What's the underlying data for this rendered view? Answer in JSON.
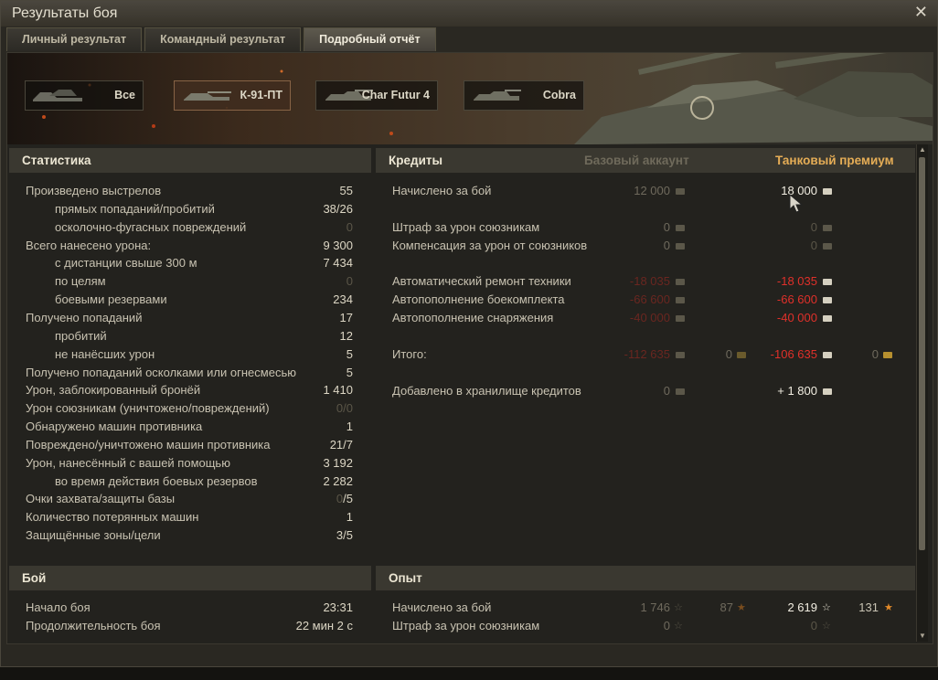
{
  "window": {
    "title": "Результаты боя"
  },
  "tabs": [
    "Личный результат",
    "Командный результат",
    "Подробный отчёт"
  ],
  "vehicles": [
    {
      "name": "Все",
      "icon": "tank-group-icon"
    },
    {
      "name": "К-91-ПТ",
      "icon": "tank-destroyer-icon"
    },
    {
      "name": "Char Futur 4",
      "icon": "medium-tank-icon"
    },
    {
      "name": "Cobra",
      "icon": "medium-tank-icon"
    }
  ],
  "stats": {
    "header": "Статистика",
    "rows": [
      {
        "label": "Произведено выстрелов",
        "value": "55",
        "indent": false,
        "dim": false
      },
      {
        "label": "прямых попаданий/пробитий",
        "value": "38/26",
        "indent": true,
        "dim": false
      },
      {
        "label": "осколочно-фугасных повреждений",
        "value": "0",
        "indent": true,
        "dim": true
      },
      {
        "label": "Всего нанесено урона:",
        "value": "9 300",
        "indent": false,
        "dim": false
      },
      {
        "label": "с дистанции свыше 300 м",
        "value": "7 434",
        "indent": true,
        "dim": false
      },
      {
        "label": "по целям",
        "value": "0",
        "indent": true,
        "dim": true
      },
      {
        "label": "боевыми резервами",
        "value": "234",
        "indent": true,
        "dim": false
      },
      {
        "label": "Получено попаданий",
        "value": "17",
        "indent": false,
        "dim": false
      },
      {
        "label": "пробитий",
        "value": "12",
        "indent": true,
        "dim": false
      },
      {
        "label": "не нанёсших урон",
        "value": "5",
        "indent": true,
        "dim": false
      },
      {
        "label": "Получено попаданий осколками или огнесмесью",
        "value": "5",
        "indent": false,
        "dim": false
      },
      {
        "label": "Урон, заблокированный бронёй",
        "value": "1 410",
        "indent": false,
        "dim": false
      },
      {
        "label": "Урон союзникам (уничтожено/повреждений)",
        "value": "0/0",
        "indent": false,
        "dim": true
      },
      {
        "label": "Обнаружено машин противника",
        "value": "1",
        "indent": false,
        "dim": false
      },
      {
        "label": "Повреждено/уничтожено машин противника",
        "value": "21/7",
        "indent": false,
        "dim": false
      },
      {
        "label": "Урон, нанесённый с вашей помощью",
        "value": "3 192",
        "indent": false,
        "dim": false
      },
      {
        "label": "во время действия боевых резервов",
        "value": "2 282",
        "indent": true,
        "dim": false
      },
      {
        "label": "Очки захвата/защиты базы",
        "value_dim": "0",
        "value": "/5",
        "indent": false,
        "dim": false
      },
      {
        "label": "Количество потерянных машин",
        "value": "1",
        "indent": false,
        "dim": false
      },
      {
        "label": "Защищённые зоны/цели",
        "value": "3/5",
        "indent": false,
        "dim": false
      }
    ]
  },
  "credits": {
    "header": "Кредиты",
    "col_base": "Базовый аккаунт",
    "col_premium": "Танковый премиум",
    "rows": [
      {
        "label": "Начислено за бой",
        "base": "12 000",
        "premium": "18 000",
        "kind": "normal"
      },
      {
        "label": "Штраф за урон союзникам",
        "base": "0",
        "premium": "0",
        "kind": "zero"
      },
      {
        "label": "Компенсация за урон от союзников",
        "base": "0",
        "premium": "0",
        "kind": "zero"
      },
      {
        "label": "Автоматический ремонт техники",
        "base": "-18 035",
        "premium": "-18 035",
        "kind": "neg"
      },
      {
        "label": "Автопополнение боекомплекта",
        "base": "-66 600",
        "premium": "-66 600",
        "kind": "neg"
      },
      {
        "label": "Автопополнение снаряжения",
        "base": "-40 000",
        "premium": "-40 000",
        "kind": "neg"
      },
      {
        "label": "Итого:",
        "base": "-112 635",
        "base_gold": "0",
        "premium": "-106 635",
        "premium_gold": "0",
        "kind": "total"
      },
      {
        "label": "Добавлено в хранилище кредитов",
        "base": "0",
        "premium": "+ 1 800",
        "kind": "store"
      }
    ]
  },
  "battle": {
    "header": "Бой",
    "rows": [
      {
        "label": "Начало боя",
        "value": "23:31"
      },
      {
        "label": "Продолжительность боя",
        "value": "22 мин 2 с"
      }
    ]
  },
  "experience": {
    "header": "Опыт",
    "rows": [
      {
        "label": "Начислено за бой",
        "base": "1 746",
        "base_free": "87",
        "premium": "2 619",
        "premium_free": "131"
      },
      {
        "label": "Штраф за урон союзникам",
        "base": "0",
        "premium": "0"
      }
    ]
  }
}
